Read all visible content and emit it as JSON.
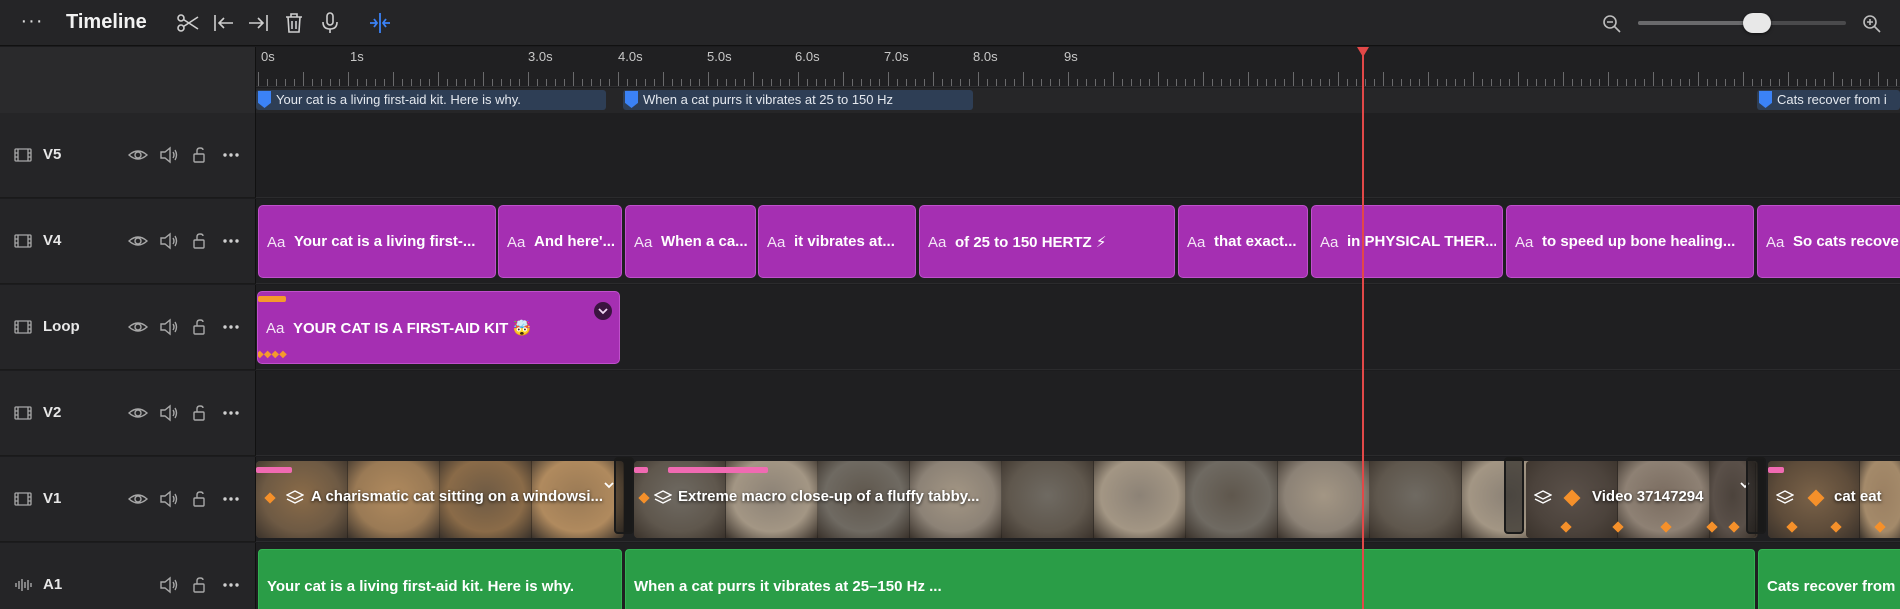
{
  "toolbar": {
    "title": "Timeline",
    "more_icon": "ellipsis-icon",
    "tools": [
      "scissors-icon",
      "trim-start-icon",
      "trim-end-icon",
      "trash-icon",
      "microphone-icon",
      "snap-icon"
    ],
    "zoom_level": 0.57
  },
  "ruler": {
    "labels": [
      "0s",
      "1s",
      "3.0s",
      "4.0s",
      "5.0s",
      "6.0s",
      "7.0s",
      "8.0s",
      "9s"
    ]
  },
  "markers": [
    {
      "label": "Your cat is a living first-aid kit. Here is why."
    },
    {
      "label": "When a cat purrs it vibrates at 25 to 150 Hz"
    },
    {
      "label": "Cats recover from i"
    }
  ],
  "tracks": [
    {
      "name": "V5"
    },
    {
      "name": "V4"
    },
    {
      "name": "Loop"
    },
    {
      "name": "V2"
    },
    {
      "name": "V1"
    },
    {
      "name": "A1"
    }
  ],
  "v4_clips": [
    {
      "aa": "Aa",
      "text": "Your cat is a living first-..."
    },
    {
      "aa": "Aa",
      "text": "And here'..."
    },
    {
      "aa": "Aa",
      "text": "When a ca..."
    },
    {
      "aa": "Aa",
      "text": "it vibrates at..."
    },
    {
      "aa": "Aa",
      "text": "of 25 to 150 HERTZ ⚡"
    },
    {
      "aa": "Aa",
      "text": "that exact..."
    },
    {
      "aa": "Aa",
      "text": "in PHYSICAL THER..."
    },
    {
      "aa": "Aa",
      "text": "to speed up bone healing..."
    },
    {
      "aa": "Aa",
      "text": "So cats recove"
    }
  ],
  "loop_clip": {
    "aa": "Aa",
    "text": "YOUR CAT IS A FIRST-AID KIT 🤯",
    "keyframes": "◆◆◆◆"
  },
  "v1_clips": [
    {
      "text": "A charismatic cat sitting on a windowsi..."
    },
    {
      "text": "Extreme macro close-up of a fluffy tabby..."
    },
    {
      "text": "Video 37147294"
    },
    {
      "text": "cat eat"
    }
  ],
  "a1_clips": [
    {
      "text": "Your cat is a living first-aid kit. Here is why."
    },
    {
      "text": "When a cat purrs it vibrates at 25–150 Hz ..."
    },
    {
      "text": "Cats recover from"
    }
  ],
  "colors": {
    "title_clip": "#a52fb2",
    "audio_clip": "#2a9d47",
    "playhead": "#e24848",
    "marker_flag": "#3b82f6",
    "accent": "#3b82f6"
  }
}
